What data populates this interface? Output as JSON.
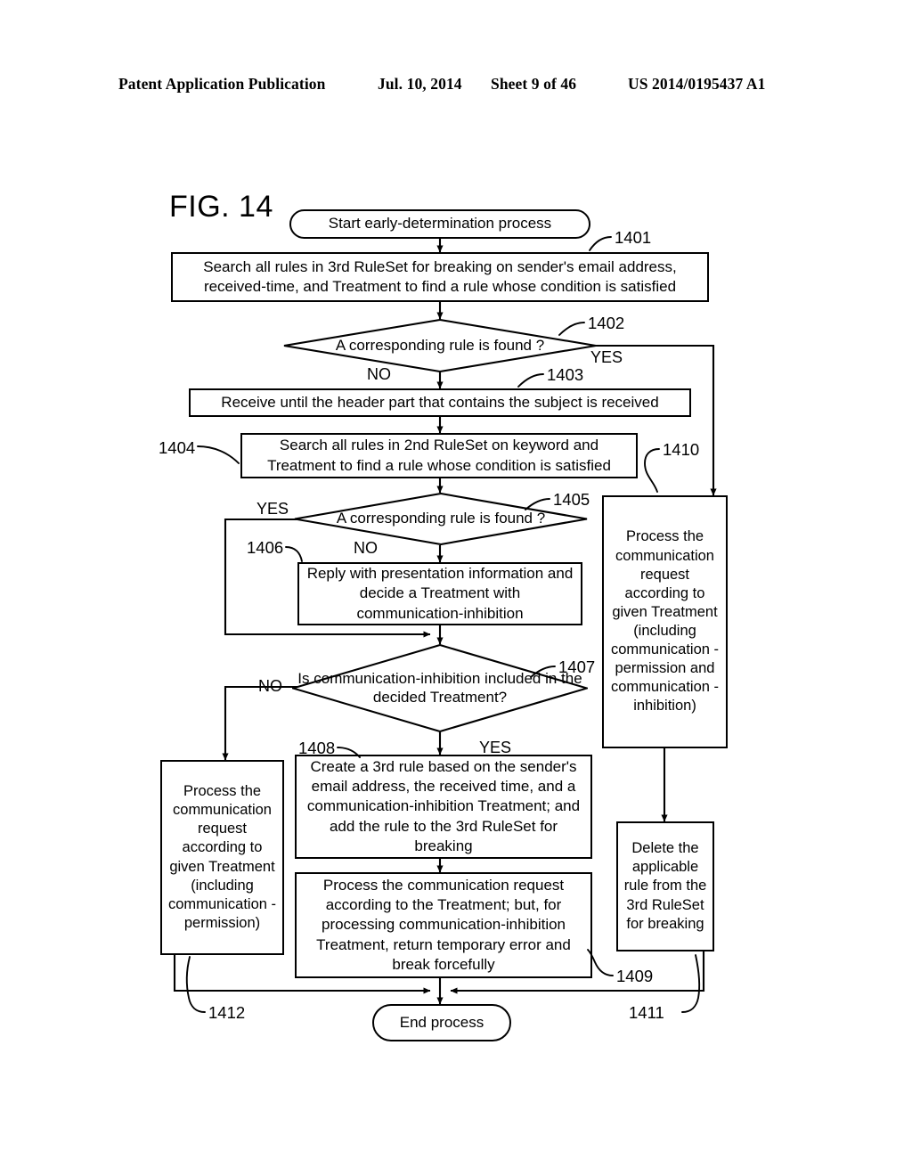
{
  "header": {
    "publication": "Patent Application Publication",
    "date": "Jul. 10, 2014",
    "sheet": "Sheet 9 of 46",
    "patent_number": "US 2014/0195437 A1"
  },
  "figure": {
    "label": "FIG. 14"
  },
  "flow": {
    "start": {
      "ref": "",
      "text": "Start early-determination process"
    },
    "step_1401": {
      "ref": "1401",
      "text": "Search all rules in 3rd RuleSet for breaking on sender's email address, received-time, and Treatment to find a rule whose condition is satisfied"
    },
    "decision_1402": {
      "ref": "1402",
      "text": "A corresponding rule is found ?",
      "yes_label": "YES",
      "no_label": "NO"
    },
    "step_1403": {
      "ref": "1403",
      "text": "Receive until the header part that contains the subject is received"
    },
    "step_1404": {
      "ref": "1404",
      "text": "Search all rules in 2nd RuleSet on keyword and Treatment to find a rule whose condition is satisfied"
    },
    "decision_1405": {
      "ref": "1405",
      "text": "A corresponding rule is found ?",
      "yes_label": "YES",
      "no_label": "NO"
    },
    "step_1406": {
      "ref": "1406",
      "text": "Reply with presentation information and decide a Treatment with communication-inhibition"
    },
    "decision_1407": {
      "ref": "1407",
      "text": "Is communication-inhibition included in the decided Treatment?",
      "yes_label": "YES",
      "no_label": "NO"
    },
    "step_1408": {
      "ref": "1408",
      "text": "Create a 3rd rule based on the sender's email address, the received time, and a communication-inhibition Treatment; and add the rule to the 3rd RuleSet for breaking"
    },
    "step_1409": {
      "ref": "1409",
      "text": "Process the communication request according to the Treatment; but, for processing communication-inhibition Treatment, return temporary error and break forcefully"
    },
    "step_1410": {
      "ref": "1410",
      "text": "Process the communication request according to given Treatment (including communication -permission and communication -inhibition)"
    },
    "step_1411": {
      "ref": "1411",
      "text": "Delete the applicable rule from the 3rd RuleSet for breaking"
    },
    "step_1412": {
      "ref": "1412",
      "text": "Process the communication request according to given Treatment (including communication -permission)"
    },
    "end": {
      "text": "End process"
    }
  },
  "colors": {
    "ink": "#000000",
    "page": "#ffffff"
  }
}
